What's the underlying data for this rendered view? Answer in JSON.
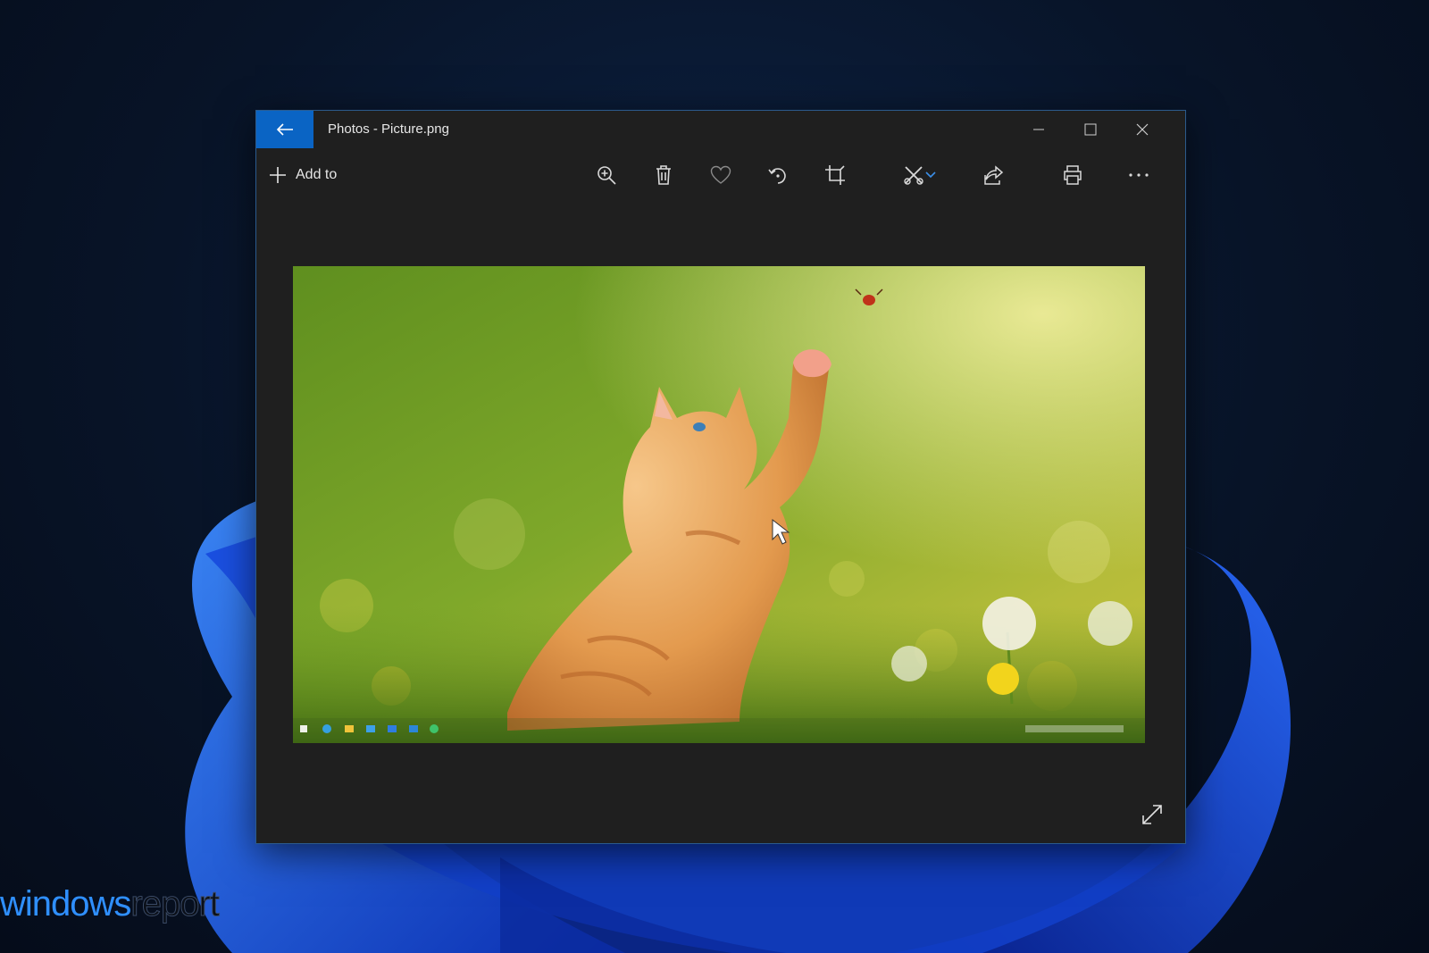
{
  "window": {
    "title": "Photos - Picture.png",
    "accent": "#0a64c4"
  },
  "titlebar": {
    "back_icon": "arrow-left-icon",
    "controls": [
      "minimize-icon",
      "maximize-icon",
      "close-icon"
    ]
  },
  "toolbar": {
    "add_to_label": "Add to",
    "actions": [
      "zoom-in-icon",
      "delete-icon",
      "favorite-heart-icon",
      "rotate-icon",
      "crop-icon",
      "edit-draw-icon",
      "chevron-down-icon",
      "share-icon",
      "print-icon",
      "more-icon"
    ]
  },
  "viewer": {
    "expand_icon": "expand-icon"
  },
  "watermark": {
    "part1": "windows",
    "part2": "report"
  }
}
